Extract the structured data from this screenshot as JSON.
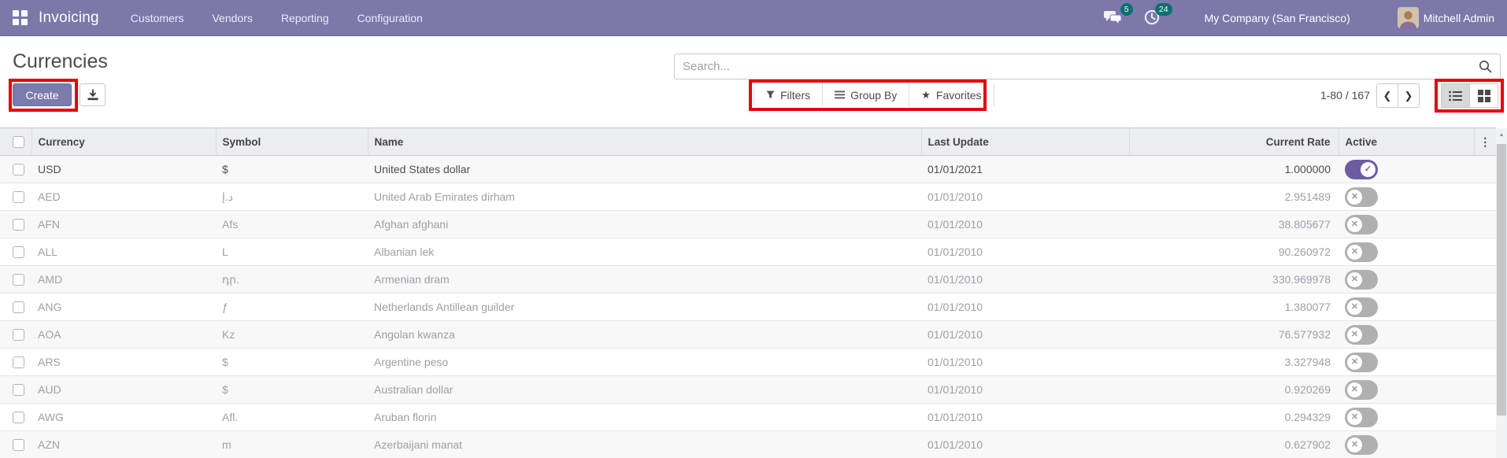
{
  "navbar": {
    "app_name": "Invoicing",
    "menus": [
      "Customers",
      "Vendors",
      "Reporting",
      "Configuration"
    ],
    "messages_badge": "5",
    "activities_badge": "24",
    "company": "My Company (San Francisco)",
    "user": "Mitchell Admin"
  },
  "control_panel": {
    "title": "Currencies",
    "create_label": "Create",
    "search_placeholder": "Search...",
    "filters_label": "Filters",
    "group_by_label": "Group By",
    "favorites_label": "Favorites",
    "pager": "1-80 / 167"
  },
  "icons": {
    "apps": "grid-2x2",
    "messages": "chat-bubbles",
    "activities": "clock",
    "export": "download-arrow",
    "search": "magnifier",
    "filter": "funnel",
    "group_by": "list-lines",
    "star": "★",
    "prev": "❮",
    "next": "❯",
    "list_view": "list-bullets",
    "kanban_view": "squares-2x2",
    "kebab": "⋮",
    "check": "✓",
    "cross": "✕",
    "scroll_up": "▲"
  },
  "colors": {
    "navbar_bg": "#7d78aa",
    "badge_teal": "#0d6f6f",
    "create_btn": "#7c7bad",
    "toggle_active": "#6d5ca3",
    "toggle_inactive": "#b0b0b0",
    "annotation_red": "#e8000d",
    "header_bg": "#ecedf0"
  },
  "table": {
    "columns": {
      "currency": "Currency",
      "symbol": "Symbol",
      "name": "Name",
      "last_update": "Last Update",
      "rate": "Current Rate",
      "active": "Active"
    },
    "rows": [
      {
        "currency": "USD",
        "symbol": "$",
        "name": "United States dollar",
        "last_update": "01/01/2021",
        "rate": "1.000000",
        "active": true
      },
      {
        "currency": "AED",
        "symbol": "د.إ",
        "name": "United Arab Emirates dirham",
        "last_update": "01/01/2010",
        "rate": "2.951489",
        "active": false
      },
      {
        "currency": "AFN",
        "symbol": "Afs",
        "name": "Afghan afghani",
        "last_update": "01/01/2010",
        "rate": "38.805677",
        "active": false
      },
      {
        "currency": "ALL",
        "symbol": "L",
        "name": "Albanian lek",
        "last_update": "01/01/2010",
        "rate": "90.260972",
        "active": false
      },
      {
        "currency": "AMD",
        "symbol": "դր.",
        "name": "Armenian dram",
        "last_update": "01/01/2010",
        "rate": "330.969978",
        "active": false
      },
      {
        "currency": "ANG",
        "symbol": "ƒ",
        "name": "Netherlands Antillean guilder",
        "last_update": "01/01/2010",
        "rate": "1.380077",
        "active": false
      },
      {
        "currency": "AOA",
        "symbol": "Kz",
        "name": "Angolan kwanza",
        "last_update": "01/01/2010",
        "rate": "76.577932",
        "active": false
      },
      {
        "currency": "ARS",
        "symbol": "$",
        "name": "Argentine peso",
        "last_update": "01/01/2010",
        "rate": "3.327948",
        "active": false
      },
      {
        "currency": "AUD",
        "symbol": "$",
        "name": "Australian dollar",
        "last_update": "01/01/2010",
        "rate": "0.920269",
        "active": false
      },
      {
        "currency": "AWG",
        "symbol": "Afl.",
        "name": "Aruban florin",
        "last_update": "01/01/2010",
        "rate": "0.294329",
        "active": false
      },
      {
        "currency": "AZN",
        "symbol": "m",
        "name": "Azerbaijani manat",
        "last_update": "01/01/2010",
        "rate": "0.627902",
        "active": false
      }
    ]
  }
}
